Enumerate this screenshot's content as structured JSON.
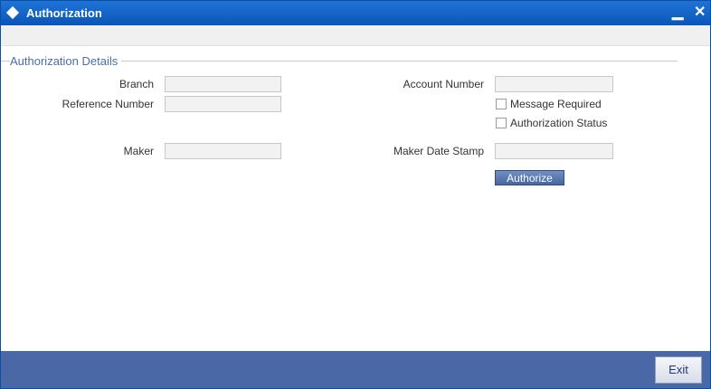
{
  "window": {
    "title": "Authorization",
    "minimize_symbol": "▁",
    "close_symbol": "✕"
  },
  "section": {
    "title": "Authorization Details"
  },
  "fields": {
    "branch_label": "Branch",
    "branch_value": "",
    "reference_label": "Reference Number",
    "reference_value": "",
    "maker_label": "Maker",
    "maker_value": "",
    "account_label": "Account Number",
    "account_value": "",
    "maker_date_label": "Maker Date Stamp",
    "maker_date_value": ""
  },
  "checkboxes": {
    "message_required_label": "Message Required",
    "message_required_checked": false,
    "authorization_status_label": "Authorization Status",
    "authorization_status_checked": false
  },
  "buttons": {
    "authorize_label": "Authorize",
    "exit_label": "Exit"
  },
  "colors": {
    "titlebar": "#0a55b8",
    "section_title": "#4a6ea8",
    "footer": "#4b68a6",
    "authorize_button": "#49679f"
  },
  "icons": {
    "title_icon": "diamond-icon"
  }
}
